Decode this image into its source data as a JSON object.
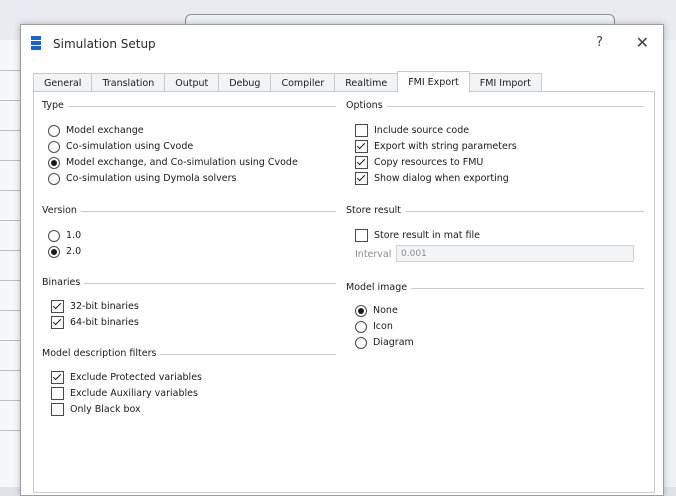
{
  "dialog": {
    "title": "Simulation Setup",
    "help_label": "?",
    "close_label": "✕",
    "icon": "app-logo-icon"
  },
  "tabs": [
    {
      "label": "General",
      "active": false
    },
    {
      "label": "Translation",
      "active": false
    },
    {
      "label": "Output",
      "active": false
    },
    {
      "label": "Debug",
      "active": false
    },
    {
      "label": "Compiler",
      "active": false
    },
    {
      "label": "Realtime",
      "active": false
    },
    {
      "label": "FMI Export",
      "active": true
    },
    {
      "label": "FMI Import",
      "active": false
    }
  ],
  "type_group": {
    "title": "Type",
    "options": [
      {
        "label": "Model exchange",
        "selected": false
      },
      {
        "label": "Co-simulation using Cvode",
        "selected": false
      },
      {
        "label": "Model exchange, and Co-simulation using Cvode",
        "selected": true
      },
      {
        "label": "Co-simulation using Dymola solvers",
        "selected": false
      }
    ]
  },
  "options_group": {
    "title": "Options",
    "items": [
      {
        "label": "Include source code",
        "checked": false
      },
      {
        "label": "Export with string parameters",
        "checked": true
      },
      {
        "label": "Copy resources to FMU",
        "checked": true
      },
      {
        "label": "Show dialog when exporting",
        "checked": true
      }
    ]
  },
  "version_group": {
    "title": "Version",
    "options": [
      {
        "label": "1.0",
        "selected": false
      },
      {
        "label": "2.0",
        "selected": true
      }
    ]
  },
  "store_group": {
    "title": "Store result",
    "checkbox_label": "Store result in mat file",
    "checked": false,
    "interval_label": "Interval",
    "interval_value": "0.001"
  },
  "binaries_group": {
    "title": "Binaries",
    "items": [
      {
        "label": "32-bit binaries",
        "checked": true
      },
      {
        "label": "64-bit binaries",
        "checked": true
      }
    ]
  },
  "model_image_group": {
    "title": "Model image",
    "options": [
      {
        "label": "None",
        "selected": true
      },
      {
        "label": "Icon",
        "selected": false
      },
      {
        "label": "Diagram",
        "selected": false
      }
    ]
  },
  "filters_group": {
    "title": "Model description filters",
    "items": [
      {
        "label": "Exclude Protected variables",
        "checked": true
      },
      {
        "label": "Exclude Auxiliary variables",
        "checked": false
      },
      {
        "label": "Only Black box",
        "checked": false
      }
    ]
  }
}
